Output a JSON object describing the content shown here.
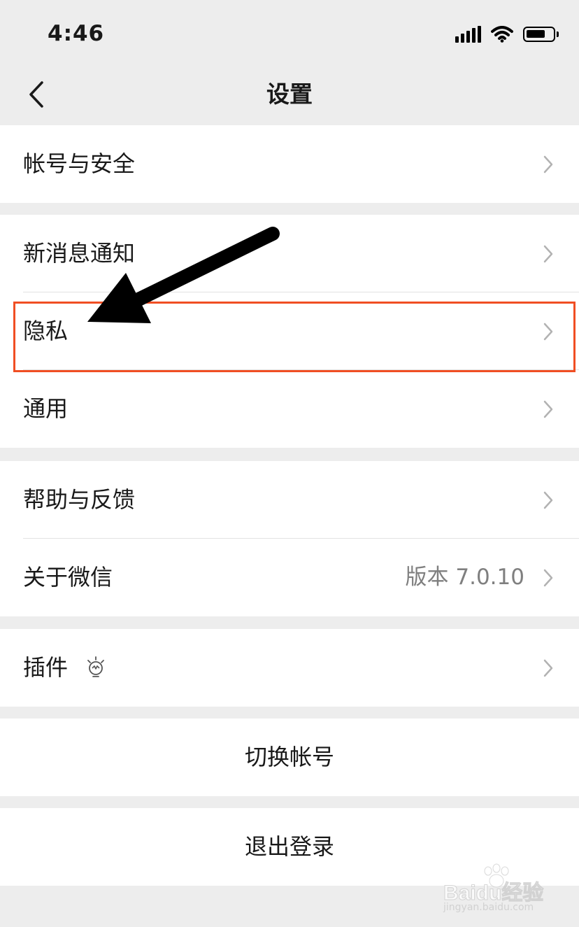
{
  "status_bar": {
    "time": "4:46"
  },
  "header": {
    "title": "设置"
  },
  "groups": [
    {
      "items": [
        {
          "label": "帐号与安全"
        }
      ]
    },
    {
      "items": [
        {
          "label": "新消息通知"
        },
        {
          "label": "隐私"
        },
        {
          "label": "通用"
        }
      ]
    },
    {
      "items": [
        {
          "label": "帮助与反馈"
        },
        {
          "label": "关于微信",
          "value": "版本 7.0.10"
        }
      ]
    },
    {
      "items": [
        {
          "label": "插件"
        }
      ]
    }
  ],
  "actions": {
    "switch_account": "切换帐号",
    "logout": "退出登录"
  },
  "watermark": {
    "text": "Baidu经验",
    "url": "jingyan.baidu.com"
  },
  "colors": {
    "background": "#ededed",
    "highlight": "#f04e23",
    "chevron": "#b2b2b2"
  },
  "icons": [
    "back-chevron-icon",
    "chevron-right-icon",
    "plugin-bulb-icon",
    "signal-icon",
    "wifi-icon",
    "battery-icon"
  ]
}
